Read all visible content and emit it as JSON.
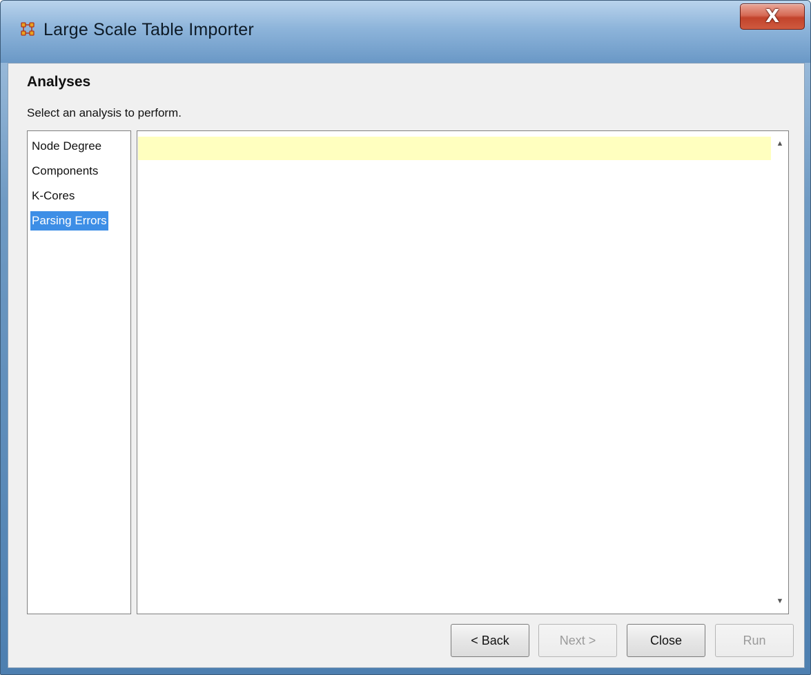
{
  "window": {
    "title": "Large Scale Table Importer",
    "close_label": "X"
  },
  "page": {
    "heading": "Analyses",
    "subtitle": "Select an analysis to perform."
  },
  "analyses": {
    "items": [
      {
        "label": "Node Degree",
        "selected": false
      },
      {
        "label": "Components",
        "selected": false
      },
      {
        "label": "K-Cores",
        "selected": false
      },
      {
        "label": "Parsing Errors",
        "selected": true
      }
    ]
  },
  "content": {
    "row_highlight_color": "#ffffbf",
    "scroll_up_icon": "scroll-up-arrow",
    "scroll_down_icon": "scroll-down-arrow"
  },
  "buttons": {
    "back": {
      "label": "< Back",
      "enabled": true
    },
    "next": {
      "label": "Next >",
      "enabled": false
    },
    "close": {
      "label": "Close",
      "enabled": true
    },
    "run": {
      "label": "Run",
      "enabled": false
    }
  },
  "colors": {
    "selection": "#3d8ee6",
    "close_button": "#c2432b"
  }
}
